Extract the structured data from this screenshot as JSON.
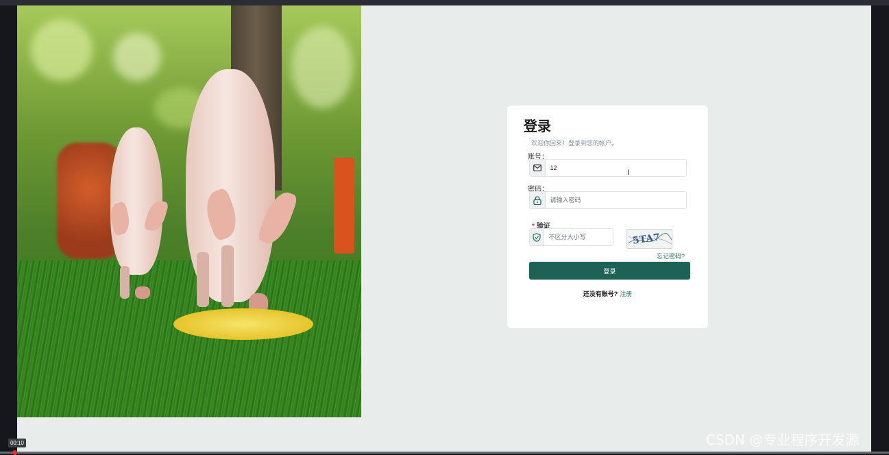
{
  "login": {
    "title": "登录",
    "subtitle": "欢迎你回来！登录到您的帐户。",
    "account_label": "账号：",
    "account_value": "12",
    "password_label": "密码：",
    "password_placeholder": "请输入密码",
    "verify_label": "验证",
    "verify_placeholder": "不区分大小写",
    "captcha_text": "5TA7",
    "forgot_label": "忘记密码?",
    "login_button": "登录",
    "no_account_text": "还没有账号?",
    "register_link": "注册"
  },
  "video": {
    "time": "00:10"
  },
  "watermark": "CSDN @专业程序开发源",
  "colors": {
    "primary": "#1d6157",
    "link": "#2a6a5e",
    "page_bg": "#e8edec",
    "required": "#e04040"
  },
  "icons": {
    "account": "envelope-icon",
    "password": "lock-icon",
    "verify": "shield-check-icon"
  }
}
